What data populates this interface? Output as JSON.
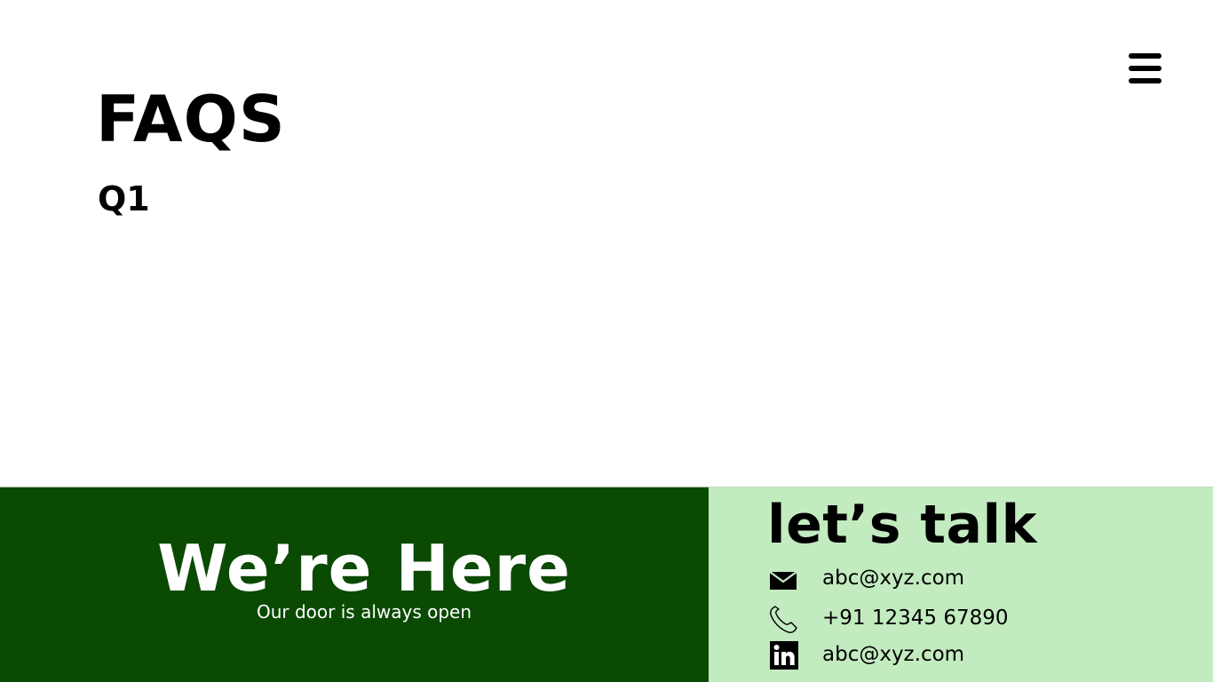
{
  "header": {
    "menu_icon": "hamburger-menu-icon"
  },
  "faq": {
    "title": "FAQS",
    "question_label": "Q1"
  },
  "footer": {
    "left": {
      "headline": "We’re Here",
      "tagline": "Our door is always open"
    },
    "right": {
      "title": "let’s talk",
      "contacts": [
        {
          "icon": "mail-icon",
          "text": "abc@xyz.com"
        },
        {
          "icon": "phone-icon",
          "text": "+91 12345 67890"
        },
        {
          "icon": "linkedin-icon",
          "text": "abc@xyz.com"
        }
      ]
    }
  },
  "colors": {
    "footer_left_bg": "#0a4a03",
    "footer_right_bg": "#c3ebc0",
    "text_dark": "#000000",
    "text_light": "#ffffff"
  }
}
